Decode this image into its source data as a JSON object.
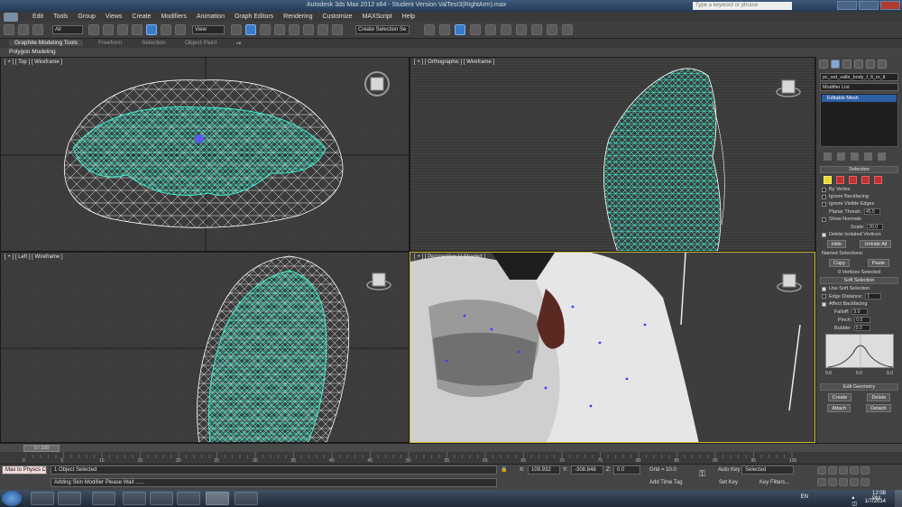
{
  "window": {
    "title": "Autodesk 3ds Max  2012 x64 - Student Version    ValTest3(RightArm).max",
    "search_placeholder": "Type a keyword or phrase"
  },
  "menu": [
    "Edit",
    "Tools",
    "Group",
    "Views",
    "Create",
    "Modifiers",
    "Animation",
    "Graph Editors",
    "Rendering",
    "Customize",
    "MAXScript",
    "Help"
  ],
  "toolbar": {
    "selection_filter": "All",
    "reference_coord": "View",
    "named_selection": "Create Selection Se"
  },
  "ribbon": {
    "tabs": [
      "Graphite Modeling Tools",
      "Freeform",
      "Selection",
      "Object Paint"
    ],
    "active_tab": "Graphite Modeling Tools",
    "panel_label": "Polygon Modeling"
  },
  "viewports": {
    "top": {
      "label": "[ + ] [ Top ] [ Wireframe ]",
      "cube": "TOP"
    },
    "ortho": {
      "label": "[ + ] [ Orthographic ] [ Wireframe ]"
    },
    "left": {
      "label": "[ + ] [ Left ] [ Wireframe ]",
      "cube": "LEFT"
    },
    "persp": {
      "label": "[ + ] [ Perspective ] [ Shaded ]",
      "cube": "BACK"
    }
  },
  "command_panel": {
    "object_name": "pc_set_valle_body_f_lt_m_lt",
    "modifier_list": "Modifier List",
    "stack_items": [
      "Editable Mesh"
    ],
    "selection": {
      "header": "Selection",
      "by_vertex": "By Vertex",
      "ignore_backfacing": "Ignore Backfacing",
      "ignore_visible_edges": "Ignore Visible Edges",
      "planar_thresh": "Planar Thresh:",
      "planar_thresh_value": "45.0",
      "show_normals": "Show Normals",
      "scale_label": "Scale:",
      "scale_value": "20.0",
      "delete_isolated": "Delete Isolated Vertices",
      "hide": "Hide",
      "unhide_all": "Unhide All",
      "named_selections": "Named Selections:",
      "copy": "Copy",
      "paste": "Paste",
      "status": "0 Vertices Selected"
    },
    "soft_selection": {
      "header": "Soft Selection",
      "use_soft": "Use Soft Selection",
      "edge_distance": "Edge Distance:",
      "edge_distance_value": "1",
      "affect_backfacing": "Affect Backfacing",
      "falloff": "Falloff:",
      "falloff_value": "9.0",
      "pinch": "Pinch:",
      "pinch_value": "0.0",
      "bubble": "Bubble:",
      "bubble_value": "0.0",
      "curve_labels": [
        "9.0",
        "0.0",
        "9.0"
      ]
    },
    "edit_geometry": {
      "header": "Edit Geometry",
      "create": "Create",
      "delete": "Delete",
      "attach": "Attach",
      "detach": "Detach"
    }
  },
  "timeline": {
    "frame": "0 / 100",
    "ticks": [
      "0",
      "5",
      "10",
      "15",
      "20",
      "25",
      "30",
      "35",
      "40",
      "45",
      "50",
      "55",
      "60",
      "65",
      "70",
      "75",
      "80",
      "85",
      "90",
      "95",
      "100"
    ]
  },
  "status": {
    "maxscript": "Max to Physcs C",
    "selected": "1 Object Selected",
    "prompt": "Adding Skin Modifier Please Wait ......",
    "x_label": "X:",
    "x_value": "109.932",
    "y_label": "Y:",
    "y_value": "-308.848",
    "z_label": "Z:",
    "z_value": "0.0",
    "grid": "Grid = 10.0",
    "add_time_tag": "Add Time Tag",
    "auto_key": "Auto Key",
    "auto_key_value": "Selected",
    "set_key": "Set Key",
    "key_filters": "Key Filters..."
  },
  "taskbar": {
    "lang": "EN",
    "time": "12:08 PM",
    "date": "1/7/2014"
  }
}
